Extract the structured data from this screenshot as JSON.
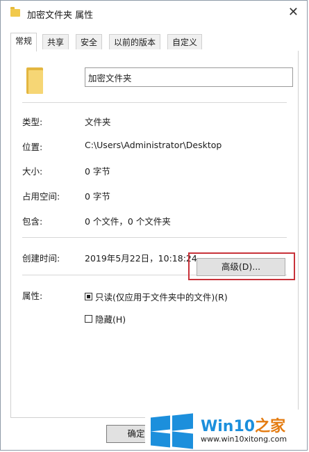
{
  "window": {
    "title": "加密文件夹 属性",
    "close_glyph": "✕"
  },
  "tabs": [
    {
      "label": "常规",
      "active": true
    },
    {
      "label": "共享",
      "active": false
    },
    {
      "label": "安全",
      "active": false
    },
    {
      "label": "以前的版本",
      "active": false
    },
    {
      "label": "自定义",
      "active": false
    }
  ],
  "general": {
    "folder_name": "加密文件夹",
    "type": {
      "label": "类型:",
      "value": "文件夹"
    },
    "location": {
      "label": "位置:",
      "value": "C:\\Users\\Administrator\\Desktop"
    },
    "size": {
      "label": "大小:",
      "value": "0 字节"
    },
    "size_on_disk": {
      "label": "占用空间:",
      "value": "0 字节"
    },
    "contains": {
      "label": "包含:",
      "value": "0 个文件，0 个文件夹"
    },
    "created": {
      "label": "创建时间:",
      "value": "2019年5月22日，10:18:24"
    },
    "attributes": {
      "label": "属性:",
      "readonly": {
        "label": "只读(仅应用于文件夹中的文件)(R)",
        "checked": true
      },
      "hidden": {
        "label": "隐藏(H)",
        "checked": false
      },
      "advanced_button": "高级(D)..."
    }
  },
  "footer": {
    "ok_label": "确定"
  },
  "watermark": {
    "brand_main": "Win10",
    "brand_accent": "之家",
    "url": "www.win10xitong.com"
  },
  "colors": {
    "highlight": "#c8323a",
    "brand_blue": "#1c8fdc",
    "brand_orange": "#e47b10"
  }
}
